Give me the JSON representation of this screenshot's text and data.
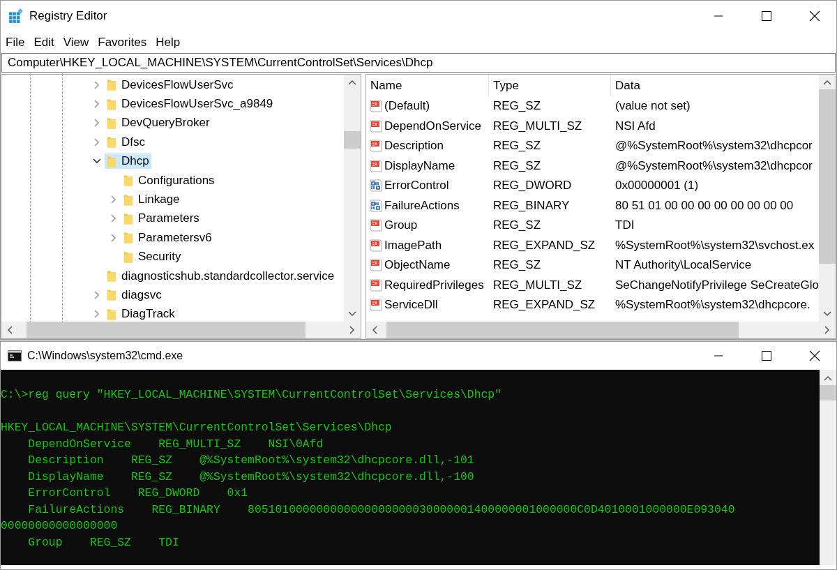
{
  "regedit": {
    "title": "Registry Editor",
    "menu": [
      "File",
      "Edit",
      "View",
      "Favorites",
      "Help"
    ],
    "address": "Computer\\HKEY_LOCAL_MACHINE\\SYSTEM\\CurrentControlSet\\Services\\Dhcp",
    "tree": [
      {
        "label": "DevicesFlowUserSvc",
        "expanded": false,
        "selected": false
      },
      {
        "label": "DevicesFlowUserSvc_a9849",
        "expanded": false,
        "selected": false
      },
      {
        "label": "DevQueryBroker",
        "expanded": false,
        "selected": false
      },
      {
        "label": "Dfsc",
        "expanded": false,
        "selected": false
      },
      {
        "label": "Dhcp",
        "expanded": true,
        "selected": true,
        "children": [
          {
            "label": "Configurations",
            "selected": false
          },
          {
            "label": "Linkage",
            "expanded": false,
            "selected": false
          },
          {
            "label": "Parameters",
            "expanded": false,
            "selected": false
          },
          {
            "label": "Parametersv6",
            "expanded": false,
            "selected": false
          },
          {
            "label": "Security",
            "selected": false
          }
        ]
      },
      {
        "label": "diagnosticshub.standardcollector.service",
        "selected": false
      },
      {
        "label": "diagsvc",
        "expanded": false,
        "selected": false
      },
      {
        "label": "DiagTrack",
        "expanded": false,
        "selected": false
      }
    ],
    "columns": [
      "Name",
      "Type",
      "Data"
    ],
    "values": [
      {
        "kind": "string",
        "name": "(Default)",
        "type": "REG_SZ",
        "data": "(value not set)"
      },
      {
        "kind": "string",
        "name": "DependOnService",
        "type": "REG_MULTI_SZ",
        "data": "NSI Afd"
      },
      {
        "kind": "string",
        "name": "Description",
        "type": "REG_SZ",
        "data": "@%SystemRoot%\\system32\\dhcpcor"
      },
      {
        "kind": "string",
        "name": "DisplayName",
        "type": "REG_SZ",
        "data": "@%SystemRoot%\\system32\\dhcpcor"
      },
      {
        "kind": "binary",
        "name": "ErrorControl",
        "type": "REG_DWORD",
        "data": "0x00000001 (1)"
      },
      {
        "kind": "binary",
        "name": "FailureActions",
        "type": "REG_BINARY",
        "data": "80 51 01 00 00 00 00 00 00 00 00"
      },
      {
        "kind": "string",
        "name": "Group",
        "type": "REG_SZ",
        "data": "TDI"
      },
      {
        "kind": "string",
        "name": "ImagePath",
        "type": "REG_EXPAND_SZ",
        "data": "%SystemRoot%\\system32\\svchost.ex"
      },
      {
        "kind": "string",
        "name": "ObjectName",
        "type": "REG_SZ",
        "data": "NT Authority\\LocalService"
      },
      {
        "kind": "string",
        "name": "RequiredPrivileges",
        "type": "REG_MULTI_SZ",
        "data": "SeChangeNotifyPrivilege SeCreateGlo"
      },
      {
        "kind": "string",
        "name": "ServiceDll",
        "type": "REG_EXPAND_SZ",
        "data": "%SystemRoot%\\system32\\dhcpcore."
      }
    ]
  },
  "cmd": {
    "title": "C:\\Windows\\system32\\cmd.exe",
    "command": "C:\\>reg query \"HKEY_LOCAL_MACHINE\\SYSTEM\\CurrentControlSet\\Services\\Dhcp\"",
    "output": [
      "HKEY_LOCAL_MACHINE\\SYSTEM\\CurrentControlSet\\Services\\Dhcp",
      "    DependOnService    REG_MULTI_SZ    NSI\\0Afd",
      "    Description    REG_SZ    @%SystemRoot%\\system32\\dhcpcore.dll,-101",
      "    DisplayName    REG_SZ    @%SystemRoot%\\system32\\dhcpcore.dll,-100",
      "    ErrorControl    REG_DWORD    0x1",
      "    FailureActions    REG_BINARY    805101000000000000000000030000001400000001000000C0D4010001000000E09304000000000000000000",
      "    Group    REG_SZ    TDI"
    ]
  }
}
